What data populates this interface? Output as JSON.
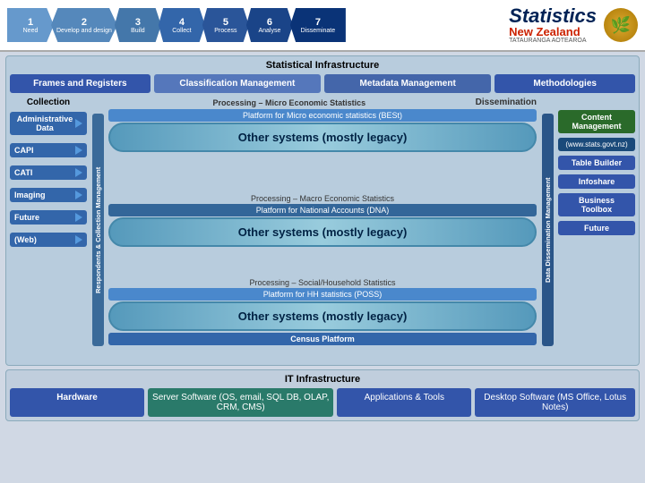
{
  "header": {
    "steps": [
      {
        "num": "1",
        "label": "Need"
      },
      {
        "num": "2",
        "label": "Develop and design"
      },
      {
        "num": "3",
        "label": "Build"
      },
      {
        "num": "4",
        "label": "Collect"
      },
      {
        "num": "5",
        "label": "Process"
      },
      {
        "num": "6",
        "label": "Analyse"
      },
      {
        "num": "7",
        "label": "Disseminate"
      }
    ],
    "logo_main": "Statistics",
    "logo_country": "New Zealand",
    "logo_tagline": "TATAURANGA AOTEAROA"
  },
  "stat_infra": {
    "title": "Statistical Infrastructure",
    "top_buttons": [
      {
        "label": "Frames and Registers"
      },
      {
        "label": "Classification Management"
      },
      {
        "label": "Metadata Management"
      },
      {
        "label": "Methodologies"
      }
    ]
  },
  "middle": {
    "collection_label": "Collection",
    "dissemination_label": "Dissemination",
    "processing_label1": "Processing – Micro Economic Statistics",
    "processing_label2": "Processing – Macro Economic Statistics",
    "processing_label3": "Processing – Social/Household Statistics",
    "platform1": "Platform for Micro economic statistics (BESt)",
    "platform2": "Platform for National Accounts (DNA)",
    "platform3": "Platform for HH statistics (POSS)",
    "legacy1": "Other systems (mostly legacy)",
    "legacy2": "Other systems (mostly legacy)",
    "legacy3": "Other systems (mostly legacy)",
    "census": "Census Platform",
    "left_items": [
      "Administrative Data",
      "CAPI",
      "CATI",
      "Imaging",
      "Future",
      "(Web)"
    ],
    "right_items": [
      "Content Management",
      "(www.stats.govt.nz)",
      "Table Builder",
      "Infoshare",
      "Business Toolbox",
      "Future"
    ],
    "vert_left": "Respondents & Collection Management",
    "vert_right": "Data Dissemination Management"
  },
  "it_infra": {
    "title": "IT Infrastructure",
    "buttons": [
      {
        "label": "Hardware"
      },
      {
        "label": "Server Software (OS, email, SQL DB, OLAP, CRM, CMS)"
      },
      {
        "label": "Applications & Tools"
      },
      {
        "label": "Desktop Software (MS Office, Lotus Notes)"
      }
    ]
  }
}
